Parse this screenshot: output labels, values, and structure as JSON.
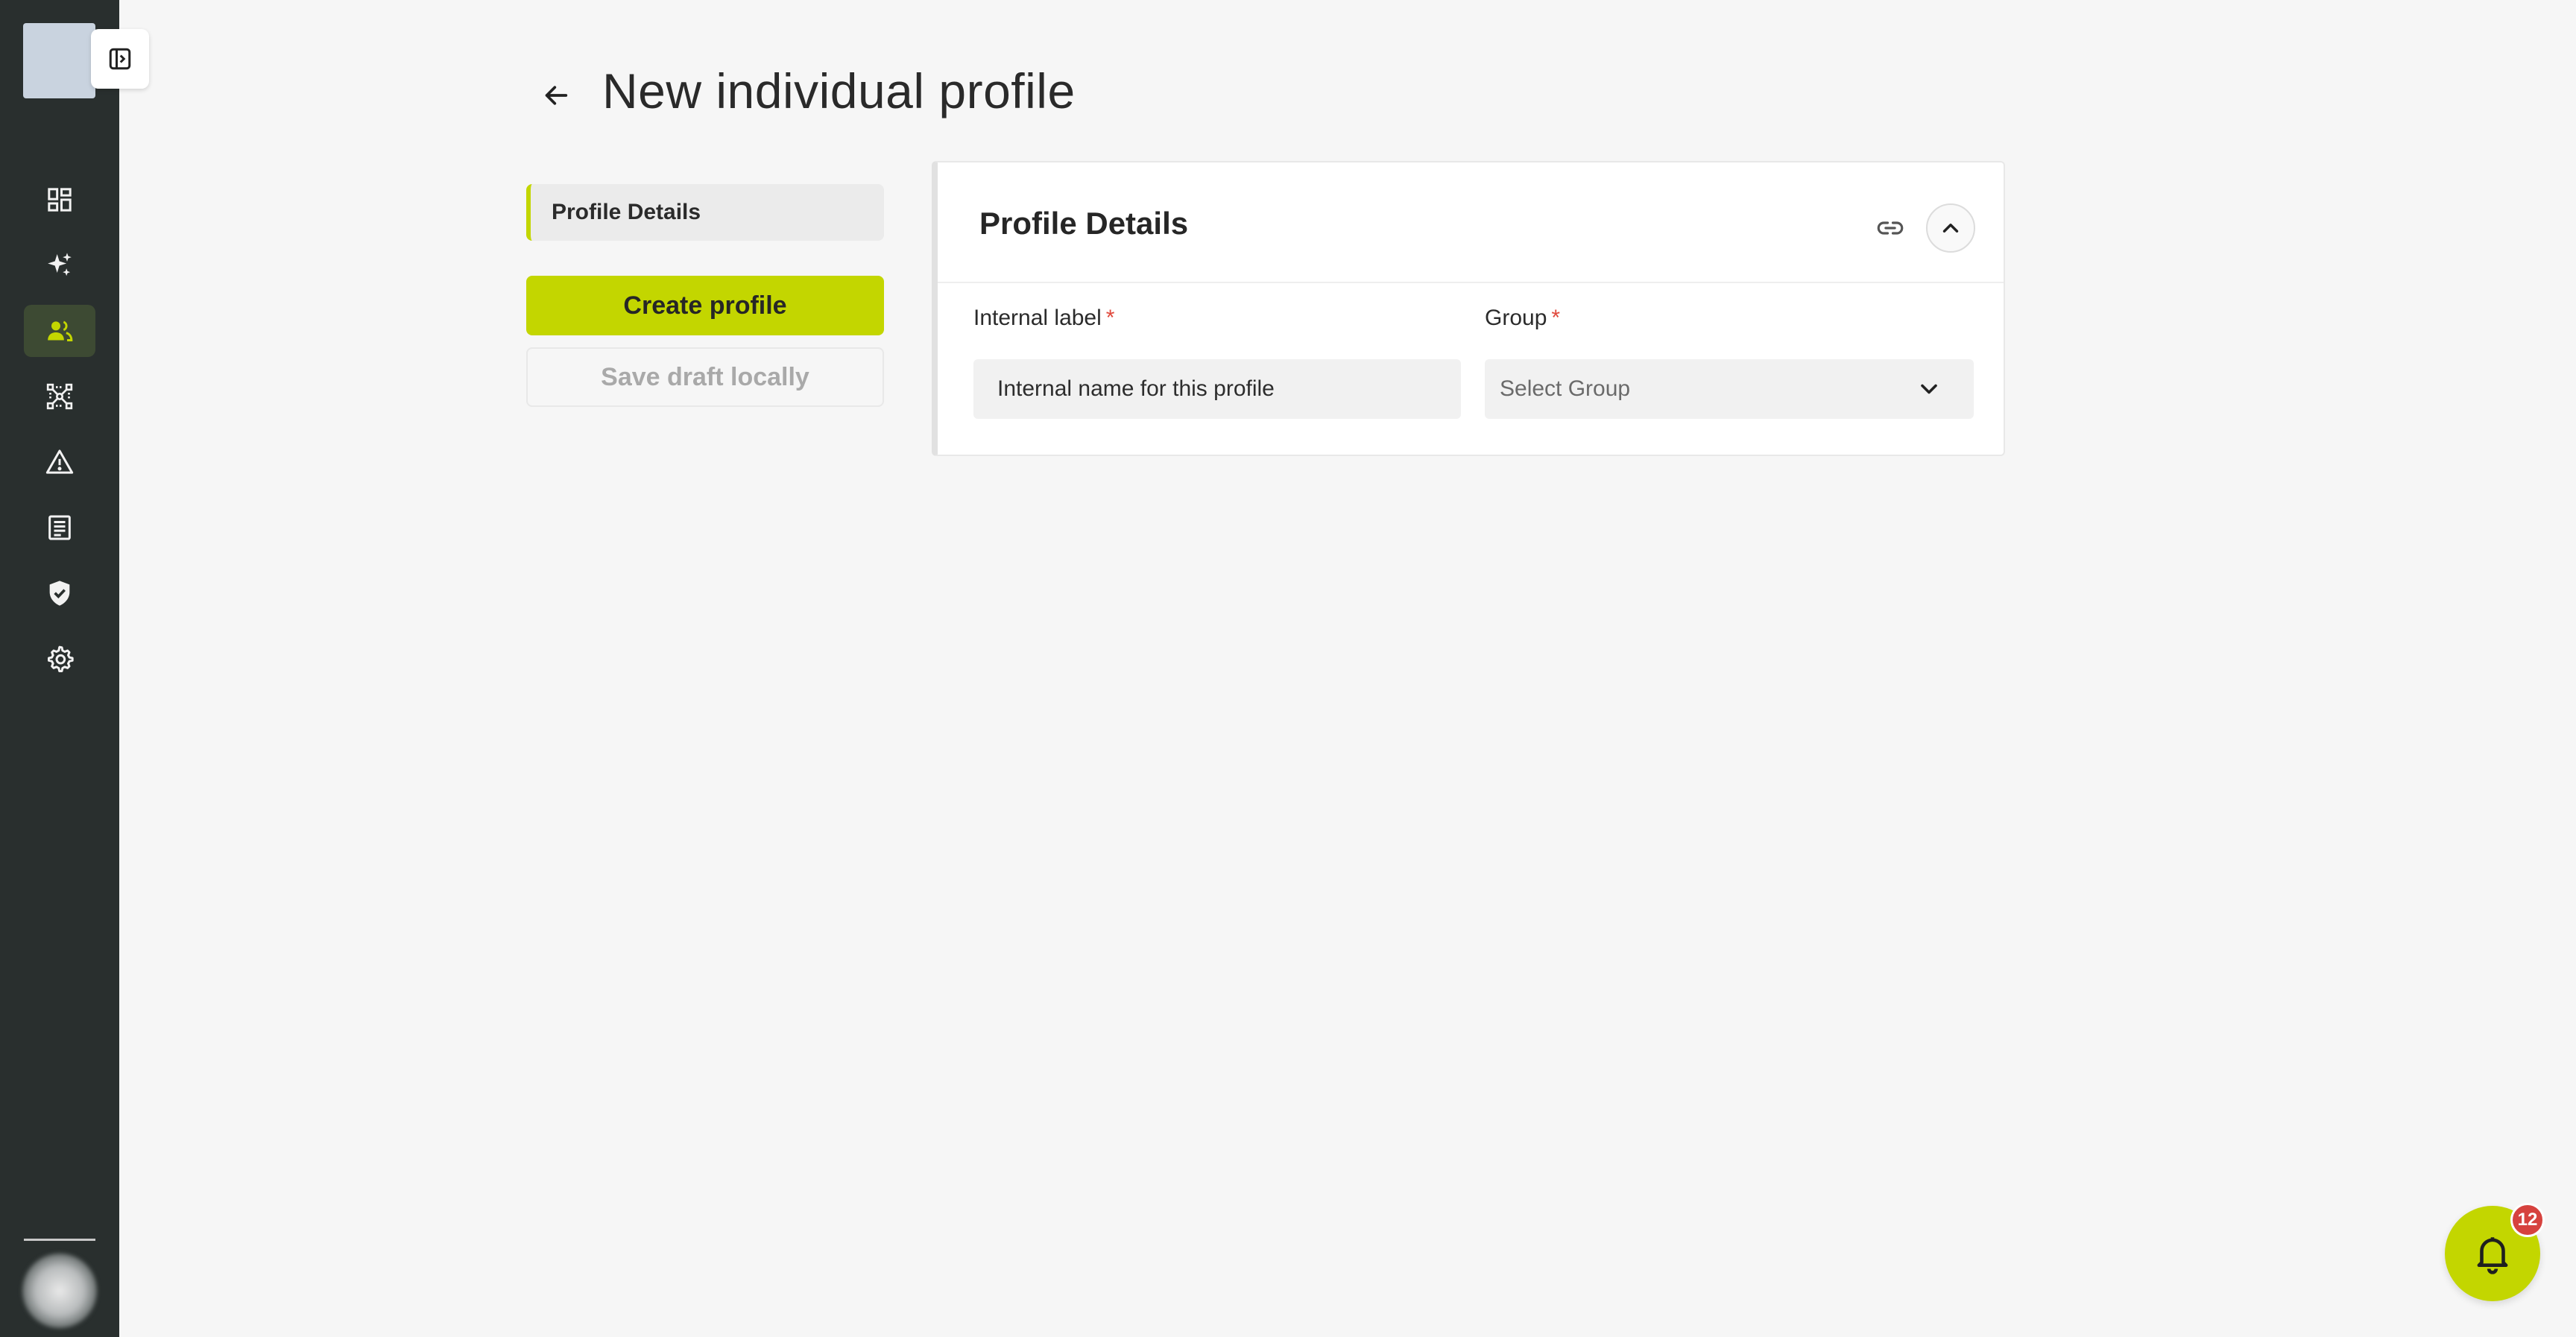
{
  "sidebar": {
    "items": [
      {
        "icon": "dashboard-icon",
        "active": false
      },
      {
        "icon": "sparkles-icon",
        "active": false
      },
      {
        "icon": "users-icon",
        "active": true
      },
      {
        "icon": "network-scan-icon",
        "active": false
      },
      {
        "icon": "warning-triangle-icon",
        "active": false
      },
      {
        "icon": "document-list-icon",
        "active": false
      },
      {
        "icon": "shield-check-icon",
        "active": false
      },
      {
        "icon": "gear-icon",
        "active": false
      }
    ]
  },
  "header": {
    "title": "New individual profile"
  },
  "section_nav": {
    "items": [
      {
        "label": "Profile Details"
      }
    ]
  },
  "actions": {
    "create_label": "Create profile",
    "draft_label": "Save draft locally"
  },
  "card": {
    "title": "Profile Details",
    "fields": {
      "internal_label": {
        "label": "Internal label",
        "required_mark": "*",
        "placeholder": "Internal name for this profile"
      },
      "group": {
        "label": "Group",
        "required_mark": "*",
        "placeholder": "Select Group"
      }
    }
  },
  "notifications": {
    "count": "12"
  },
  "colors": {
    "accent": "#c3d600",
    "sidebar_bg": "#292f2e",
    "active_icon": "#c3d600",
    "required": "#e0493c",
    "badge": "#d6423e"
  }
}
